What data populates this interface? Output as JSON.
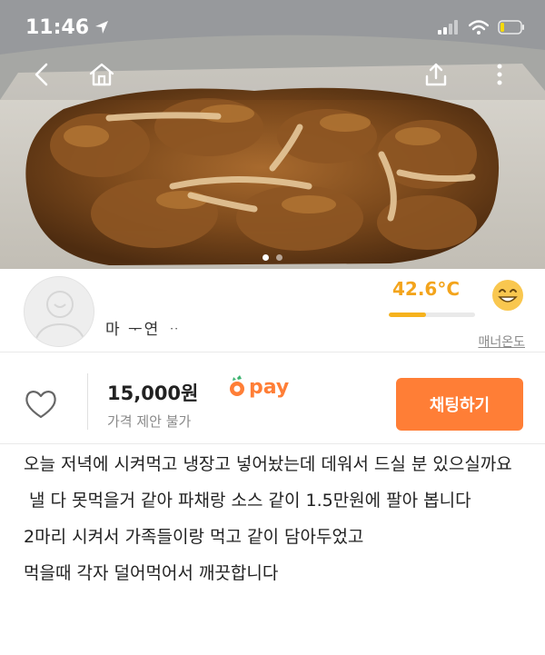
{
  "status_bar": {
    "time": "11:46"
  },
  "nav": {
    "back_icon": "chevron-left-icon",
    "home_icon": "home-icon",
    "share_icon": "share-icon",
    "more_icon": "more-vertical-icon"
  },
  "photo": {
    "total_images": 2,
    "active_index": 0
  },
  "seller": {
    "name": "마 ᅮ연 ᆢ",
    "manner_temperature": "42.6°C",
    "manner_fraction": 0.43,
    "manner_label": "매너온도"
  },
  "listing": {
    "price": "15,000원",
    "pay_label": "pay",
    "price_note": "가격 제안 불가",
    "chat_button": "채팅하기"
  },
  "description": [
    "오늘 저녁에 시켜먹고 냉장고 넣어놨는데 데워서 드실 분 있으실까요",
    "낼 다 못먹을거 같아 파채랑 소스 같이 1.5만원에 팔아 봅니다",
    "2마리 시켜서 가족들이랑 먹고 같이 담아두었고",
    "먹을때 각자 덜어먹어서 깨끗합니다"
  ],
  "colors": {
    "accent": "#ff7e36",
    "manner": "#f3a41c"
  }
}
